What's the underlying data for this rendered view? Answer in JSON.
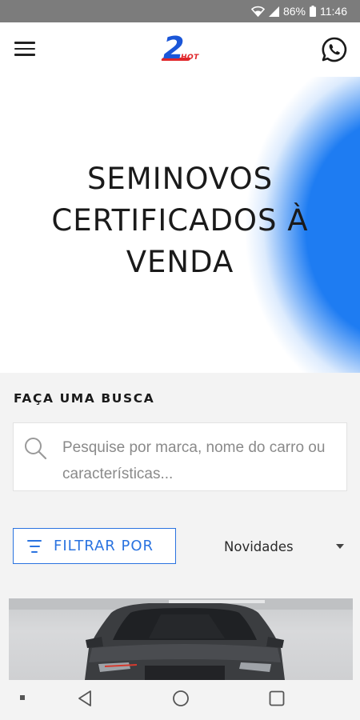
{
  "status_bar": {
    "battery": "86%",
    "time": "11:46",
    "icons": [
      "wifi-icon",
      "signal-icon",
      "battery-icon"
    ]
  },
  "header": {
    "logo_number": "2",
    "logo_text": "HOT",
    "menu_icon": "hamburger-menu-icon",
    "whatsapp_icon": "whatsapp-icon"
  },
  "hero": {
    "title_line1": "SEMINOVOS",
    "title_line2": "CERTIFICADOS À",
    "title_line3": "VENDA"
  },
  "search": {
    "heading": "FAÇA UMA BUSCA",
    "placeholder": "Pesquise por marca, nome do carro ou características..."
  },
  "filters": {
    "filter_label": "FILTRAR POR",
    "sort_selected": "Novidades"
  },
  "listing": {
    "image": "car-photo"
  },
  "colors": {
    "accent": "#2a73e0",
    "hero_blue": "#1e7cf2",
    "logo_blue": "#1b56d8",
    "logo_red": "#e0262a",
    "status_bar": "#7c7c7c"
  },
  "nav": {
    "icons": [
      "dot-icon",
      "back-icon",
      "home-icon",
      "recents-icon"
    ]
  }
}
